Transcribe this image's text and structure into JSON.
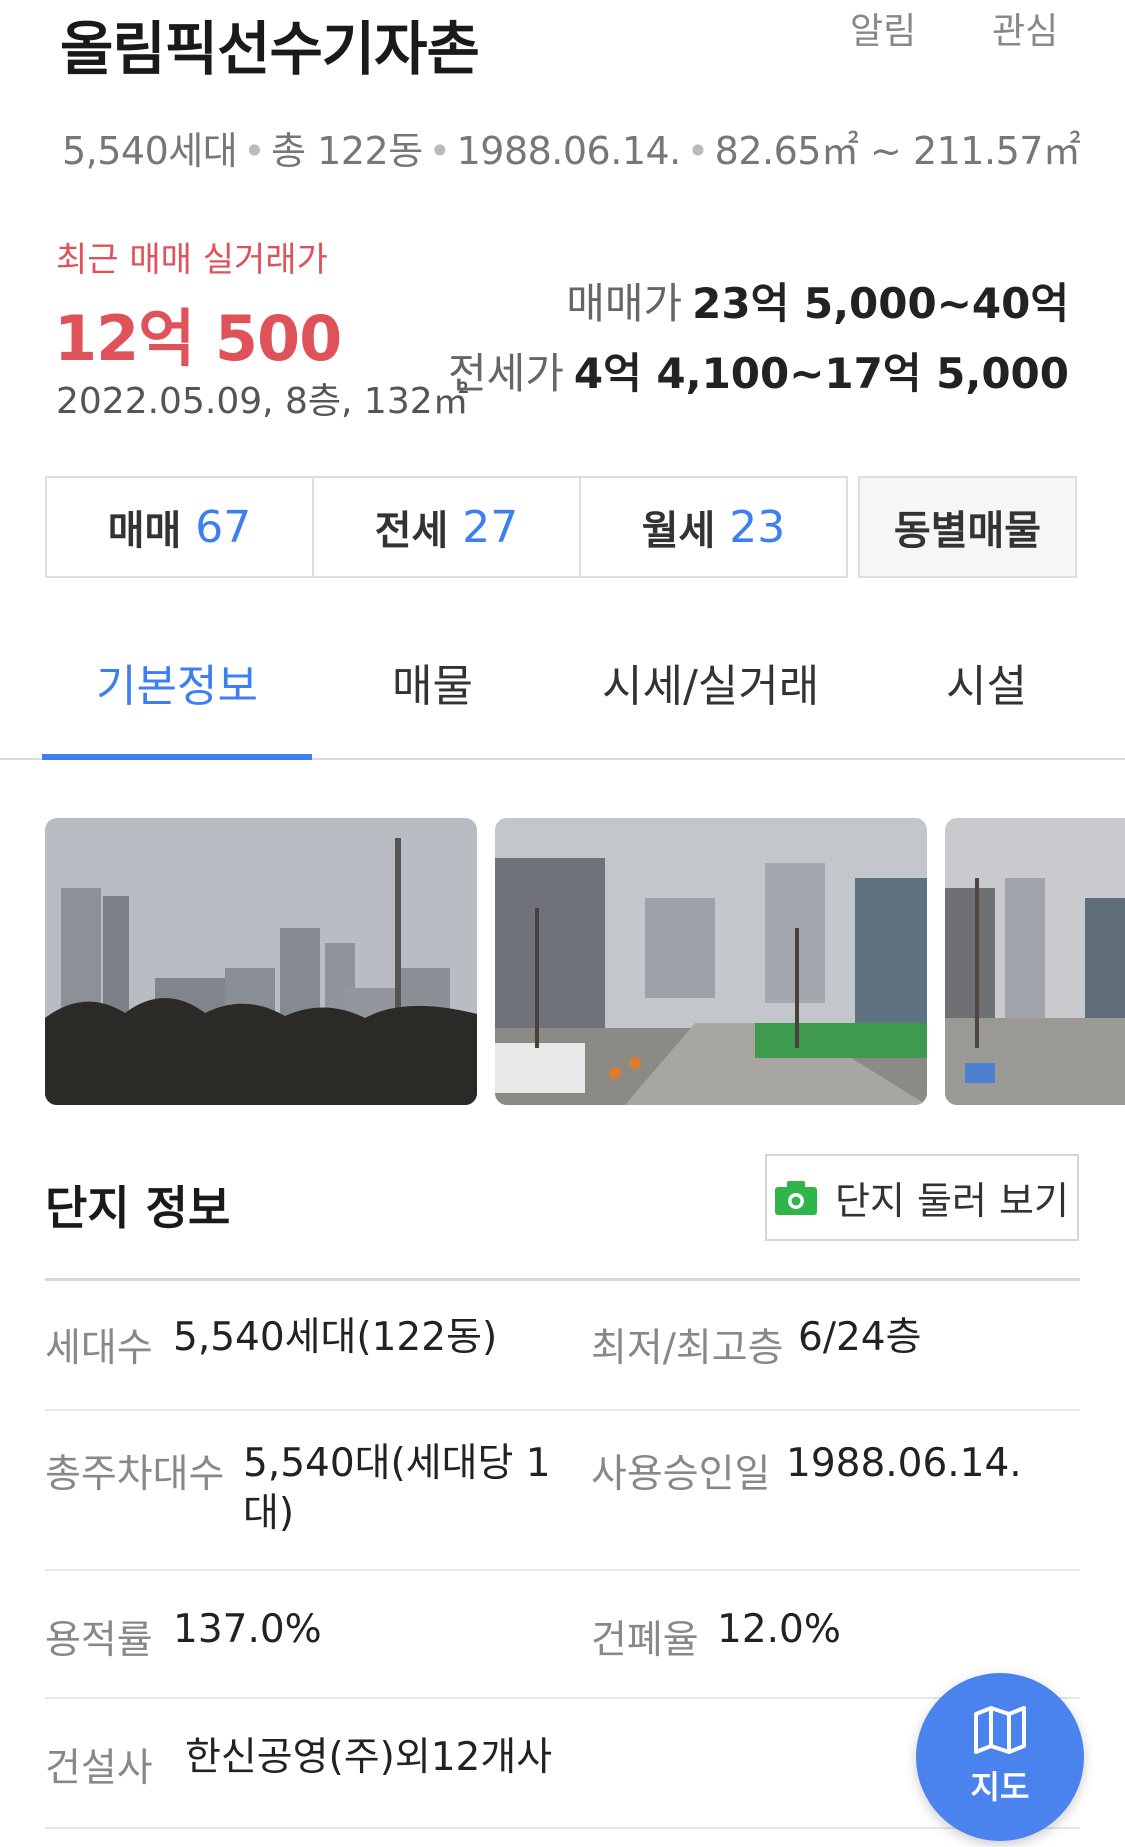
{
  "header": {
    "title": "올림픽선수기자촌",
    "alarm_label": "알림",
    "favorite_label": "관심"
  },
  "meta": {
    "households": "5,540세대",
    "buildings": "총 122동",
    "approval_date": "1988.06.14.",
    "area_range": "82.65㎡ ~ 211.57㎡"
  },
  "recent_trade": {
    "label": "최근 매매 실거래가",
    "price": "12억 500",
    "detail": "2022.05.09, 8층, 132㎡"
  },
  "prices": {
    "sale_label": "매매가",
    "sale_range": "23억 5,000~40억",
    "jeonse_label": "전세가",
    "jeonse_range": "4억 4,100~17억 5,000"
  },
  "deal_tabs": [
    {
      "label": "매매",
      "count": "67"
    },
    {
      "label": "전세",
      "count": "27"
    },
    {
      "label": "월세",
      "count": "23"
    }
  ],
  "dong_listing_label": "동별매물",
  "nav_tabs": [
    {
      "label": "기본정보",
      "active": true
    },
    {
      "label": "매물",
      "active": false
    },
    {
      "label": "시세/실거래",
      "active": false
    },
    {
      "label": "시설",
      "active": false
    }
  ],
  "complex_info": {
    "title": "단지 정보",
    "tour_button_label": "단지 둘러 보기",
    "rows": [
      {
        "label": "세대수",
        "value": "5,540세대(122동)",
        "label2": "최저/최고층",
        "value2": "6/24층"
      },
      {
        "label": "총주차대수",
        "value": "5,540대(세대당 1대)",
        "label2": "사용승인일",
        "value2": "1988.06.14."
      },
      {
        "label": "용적률",
        "value": "137.0%",
        "label2": "건폐율",
        "value2": "12.0%"
      },
      {
        "label": "건설사",
        "value": "한신공영(주)외12개사"
      }
    ]
  },
  "map_button_label": "지도",
  "colors": {
    "accent_blue": "#3d7ff0",
    "price_red": "#e0525a",
    "map_button": "#4a82ee",
    "camera_green": "#2fb64a"
  }
}
